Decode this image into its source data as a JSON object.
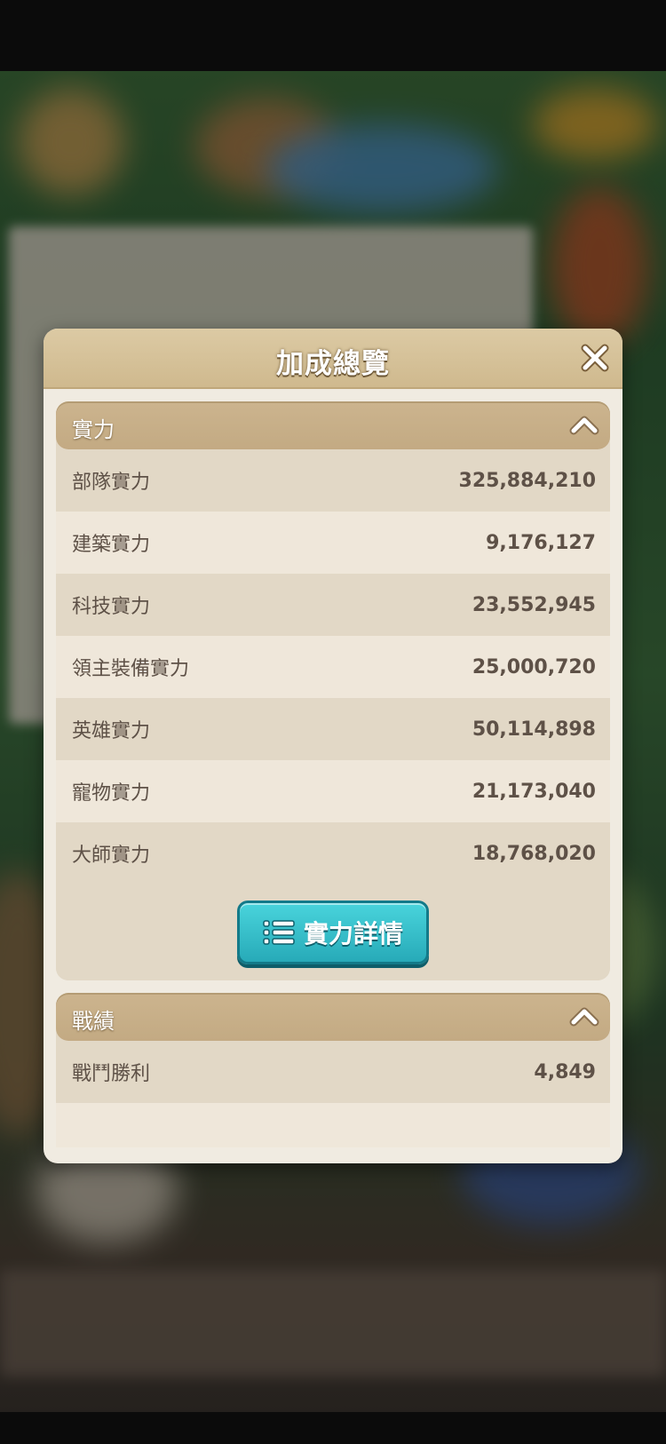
{
  "modal": {
    "title": "加成總覽"
  },
  "sections": [
    {
      "title": "實力",
      "rows": [
        {
          "label": "部隊實力",
          "value": "325,884,210"
        },
        {
          "label": "建築實力",
          "value": "9,176,127"
        },
        {
          "label": "科技實力",
          "value": "23,552,945"
        },
        {
          "label": "領主裝備實力",
          "value": "25,000,720"
        },
        {
          "label": "英雄實力",
          "value": "50,114,898"
        },
        {
          "label": "寵物實力",
          "value": "21,173,040"
        },
        {
          "label": "大師實力",
          "value": "18,768,020"
        }
      ],
      "button_label": "實力詳情"
    },
    {
      "title": "戰績",
      "rows": [
        {
          "label": "戰鬥勝利",
          "value": "4,849"
        }
      ]
    }
  ],
  "icons": {
    "close": "close-icon",
    "collapse": "chevron-up-icon",
    "list": "list-icon"
  },
  "colors": {
    "accent_button": "#27aab8",
    "header_bg": "#cfb98e",
    "row_alt": "#efe7da",
    "row_norm": "#e2d8c6"
  }
}
